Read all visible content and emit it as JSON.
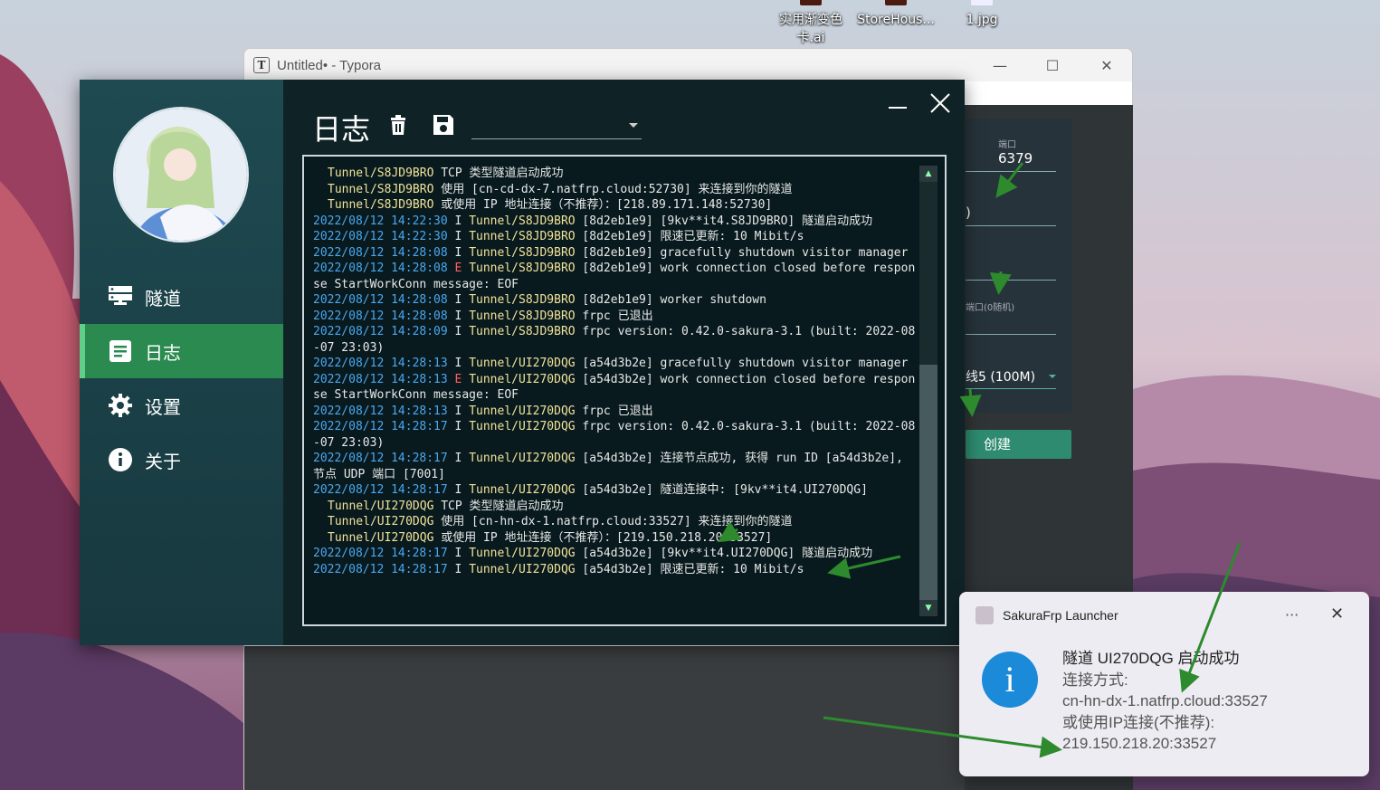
{
  "desktop": {
    "icons": [
      {
        "label_line1": "实用渐变色",
        "label_line2": "卡.ai"
      },
      {
        "label_line1": "StoreHous...",
        "label_line2": ""
      },
      {
        "label_line1": "1.jpg",
        "label_line2": ""
      }
    ]
  },
  "typora": {
    "title": "Untitled• - Typora",
    "app_icon": "T",
    "minimize": "—",
    "maximize": "☐",
    "close": "✕",
    "form": {
      "port_label": "端口",
      "port_value": "6379",
      "paren_fragment": ")",
      "random_port_label": "端口(0随机)",
      "line_fragment": "线5 (100M)",
      "create_button": "创建"
    }
  },
  "launcher": {
    "nav": [
      {
        "label": "隧道",
        "icon": "server-icon",
        "active": false
      },
      {
        "label": "日志",
        "icon": "log-icon",
        "active": true
      },
      {
        "label": "设置",
        "icon": "gear-icon",
        "active": false
      },
      {
        "label": "关于",
        "icon": "info-icon",
        "active": false
      }
    ],
    "page_title": "日志",
    "filter_value": "",
    "log": [
      {
        "indent": true,
        "tunnel": "Tunnel/S8JD9BRO",
        "rest": " TCP 类型隧道启动成功"
      },
      {
        "indent": true,
        "tunnel": "Tunnel/S8JD9BRO",
        "rest": " 使用 [cn-cd-dx-7.natfrp.cloud:52730] 来连接到你的隧道"
      },
      {
        "indent": true,
        "tunnel": "Tunnel/S8JD9BRO",
        "rest": " 或使用 IP 地址连接（不推荐）：[218.89.171.148:52730]"
      },
      {
        "time": "2022/08/12 14:22:30",
        "level": "I",
        "tunnel": "Tunnel/S8JD9BRO",
        "rest": " [8d2eb1e9] [9kv**it4.S8JD9BRO] 隧道启动成功"
      },
      {
        "time": "2022/08/12 14:22:30",
        "level": "I",
        "tunnel": "Tunnel/S8JD9BRO",
        "rest": " [8d2eb1e9] 限速已更新: 10 Mibit/s"
      },
      {
        "time": "2022/08/12 14:28:08",
        "level": "I",
        "tunnel": "Tunnel/S8JD9BRO",
        "rest": " [8d2eb1e9] gracefully shutdown visitor manager"
      },
      {
        "time": "2022/08/12 14:28:08",
        "level": "E",
        "tunnel": "Tunnel/S8JD9BRO",
        "rest": " [8d2eb1e9] work connection closed before response StartWorkConn message: EOF"
      },
      {
        "time": "2022/08/12 14:28:08",
        "level": "I",
        "tunnel": "Tunnel/S8JD9BRO",
        "rest": " [8d2eb1e9] worker shutdown"
      },
      {
        "time": "2022/08/12 14:28:08",
        "level": "I",
        "tunnel": "Tunnel/S8JD9BRO",
        "rest": " frpc 已退出"
      },
      {
        "time": "2022/08/12 14:28:09",
        "level": "I",
        "tunnel": "Tunnel/S8JD9BRO",
        "rest": " frpc version: 0.42.0-sakura-3.1 (built: 2022-08-07 23:03)"
      },
      {
        "time": "2022/08/12 14:28:13",
        "level": "I",
        "tunnel": "Tunnel/UI270DQG",
        "rest": " [a54d3b2e] gracefully shutdown visitor manager"
      },
      {
        "time": "2022/08/12 14:28:13",
        "level": "E",
        "tunnel": "Tunnel/UI270DQG",
        "rest": " [a54d3b2e] work connection closed before response StartWorkConn message: EOF"
      },
      {
        "time": "2022/08/12 14:28:13",
        "level": "I",
        "tunnel": "Tunnel/UI270DQG",
        "rest": " frpc 已退出"
      },
      {
        "time": "2022/08/12 14:28:17",
        "level": "I",
        "tunnel": "Tunnel/UI270DQG",
        "rest": " frpc version: 0.42.0-sakura-3.1 (built: 2022-08-07 23:03)"
      },
      {
        "time": "2022/08/12 14:28:17",
        "level": "I",
        "tunnel": "Tunnel/UI270DQG",
        "rest": " [a54d3b2e] 连接节点成功, 获得 run ID [a54d3b2e], 节点 UDP 端口 [7001]"
      },
      {
        "time": "2022/08/12 14:28:17",
        "level": "I",
        "tunnel": "Tunnel/UI270DQG",
        "rest": " [a54d3b2e] 隧道连接中: [9kv**it4.UI270DQG]"
      },
      {
        "indent": true,
        "tunnel": "Tunnel/UI270DQG",
        "rest": " TCP 类型隧道启动成功"
      },
      {
        "indent": true,
        "tunnel": "Tunnel/UI270DQG",
        "rest": " 使用 [cn-hn-dx-1.natfrp.cloud:33527] 来连接到你的隧道"
      },
      {
        "indent": true,
        "tunnel": "Tunnel/UI270DQG",
        "rest": " 或使用 IP 地址连接（不推荐）：[219.150.218.20:33527]"
      },
      {
        "time": "2022/08/12 14:28:17",
        "level": "I",
        "tunnel": "Tunnel/UI270DQG",
        "rest": " [a54d3b2e] [9kv**it4.UI270DQG] 隧道启动成功"
      },
      {
        "time": "2022/08/12 14:28:17",
        "level": "I",
        "tunnel": "Tunnel/UI270DQG",
        "rest": " [a54d3b2e] 限速已更新: 10 Mibit/s"
      }
    ]
  },
  "toast": {
    "app_name": "SakuraFrp Launcher",
    "more": "···",
    "close": "✕",
    "icon": "i",
    "title": "隧道 UI270DQG 启动成功",
    "line1": "连接方式:",
    "line2": "cn-hn-dx-1.natfrp.cloud:33527",
    "line3": "或使用IP连接(不推荐):",
    "line4": "219.150.218.20:33527"
  },
  "colors": {
    "accent_green": "#2a8a4f",
    "log_time": "#4aa8f0",
    "log_error": "#ff5f5f",
    "log_tunnel": "#f2e29a",
    "annotation_arrow": "#2d8a2d"
  }
}
